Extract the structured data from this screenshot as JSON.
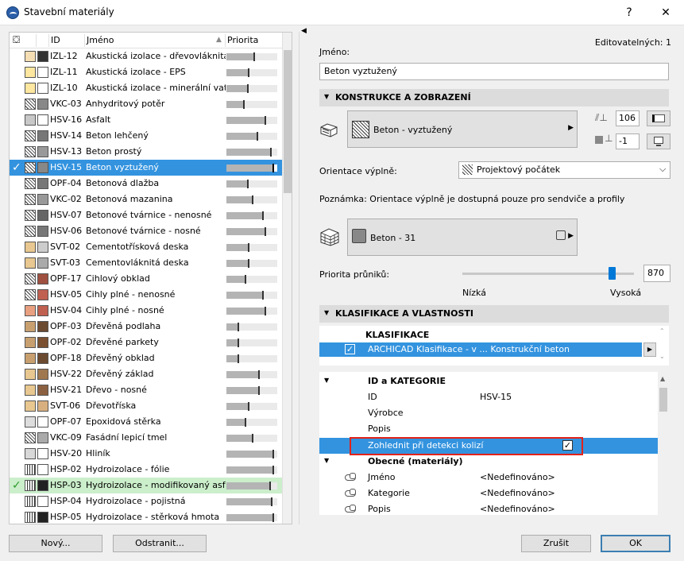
{
  "window": {
    "title": "Stavební materiály",
    "help_label": "?",
    "close_label": "✕"
  },
  "list": {
    "headers": {
      "id": "ID",
      "name": "Jméno",
      "priority": "Priorita"
    },
    "rows": [
      {
        "id": "IZL-12",
        "name": "Akustická izolace - dřevovláknitá d",
        "priority": 0.53,
        "sw1": "#f5deb3",
        "sw2": "#333333",
        "check": "",
        "state": ""
      },
      {
        "id": "IZL-11",
        "name": "Akustická izolace - EPS",
        "priority": 0.42,
        "sw1": "#ffe7a0",
        "sw2": "#ffffff",
        "check": "",
        "state": ""
      },
      {
        "id": "IZL-10",
        "name": "Akustická izolace - minerální vata",
        "priority": 0.4,
        "sw1": "#ffe7a0",
        "sw2": "#ffffff",
        "check": "",
        "state": ""
      },
      {
        "id": "VKC-03",
        "name": "Anhydritový potěr",
        "priority": 0.33,
        "sw1": "hatch",
        "sw2": "#888888",
        "check": "",
        "state": ""
      },
      {
        "id": "HSV-16",
        "name": "Asfalt",
        "priority": 0.75,
        "sw1": "#c8c8c8",
        "sw2": "#ffffff",
        "check": "",
        "state": ""
      },
      {
        "id": "HSV-14",
        "name": "Beton lehčený",
        "priority": 0.6,
        "sw1": "hatch",
        "sw2": "#777777",
        "check": "",
        "state": ""
      },
      {
        "id": "HSV-13",
        "name": "Beton prostý",
        "priority": 0.86,
        "sw1": "hatch",
        "sw2": "#999999",
        "check": "",
        "state": ""
      },
      {
        "id": "HSV-15",
        "name": "Beton vyztužený",
        "priority": 0.9,
        "sw1": "hatch",
        "sw2": "#888888",
        "check": "✓",
        "state": "sel"
      },
      {
        "id": "OPF-04",
        "name": "Betonová dlažba",
        "priority": 0.4,
        "sw1": "hatch",
        "sw2": "#777777",
        "check": "",
        "state": ""
      },
      {
        "id": "VKC-02",
        "name": "Betonová mazanina",
        "priority": 0.5,
        "sw1": "hatch",
        "sw2": "#999999",
        "check": "",
        "state": ""
      },
      {
        "id": "HSV-07",
        "name": "Betonové tvárnice - nenosné",
        "priority": 0.7,
        "sw1": "hatch",
        "sw2": "#666666",
        "check": "",
        "state": ""
      },
      {
        "id": "HSV-06",
        "name": "Betonové tvárnice - nosné",
        "priority": 0.75,
        "sw1": "hatch",
        "sw2": "#777777",
        "check": "",
        "state": ""
      },
      {
        "id": "SVT-02",
        "name": "Cementotřísková deska",
        "priority": 0.42,
        "sw1": "#e8c890",
        "sw2": "#cccccc",
        "check": "",
        "state": ""
      },
      {
        "id": "SVT-03",
        "name": "Cementovláknitá deska",
        "priority": 0.42,
        "sw1": "#e8c890",
        "sw2": "#aaaaaa",
        "check": "",
        "state": ""
      },
      {
        "id": "OPF-17",
        "name": "Cihlový obklad",
        "priority": 0.36,
        "sw1": "hatch",
        "sw2": "#a05040",
        "check": "",
        "state": ""
      },
      {
        "id": "HSV-05",
        "name": "Cihly plné - nenosné",
        "priority": 0.7,
        "sw1": "hatch",
        "sw2": "#c06050",
        "check": "",
        "state": ""
      },
      {
        "id": "HSV-04",
        "name": "Cihly plné - nosné",
        "priority": 0.75,
        "sw1": "#e8a080",
        "sw2": "#c06050",
        "check": "",
        "state": ""
      },
      {
        "id": "OPF-03",
        "name": "Dřevěná podlaha",
        "priority": 0.22,
        "sw1": "#c8a070",
        "sw2": "#6b4a30",
        "check": "",
        "state": ""
      },
      {
        "id": "OPF-02",
        "name": "Dřevěné parkety",
        "priority": 0.22,
        "sw1": "#c8a070",
        "sw2": "#7a5030",
        "check": "",
        "state": ""
      },
      {
        "id": "OPF-18",
        "name": "Dřevěný obklad",
        "priority": 0.22,
        "sw1": "#c8a070",
        "sw2": "#6b4a30",
        "check": "",
        "state": ""
      },
      {
        "id": "HSV-22",
        "name": "Dřevěný základ",
        "priority": 0.62,
        "sw1": "#e8c890",
        "sw2": "#a07850",
        "check": "",
        "state": ""
      },
      {
        "id": "HSV-21",
        "name": "Dřevo - nosné",
        "priority": 0.62,
        "sw1": "#e8c890",
        "sw2": "#8b6040",
        "check": "",
        "state": ""
      },
      {
        "id": "SVT-06",
        "name": "Dřevotříska",
        "priority": 0.42,
        "sw1": "#e8c890",
        "sw2": "#d8b080",
        "check": "",
        "state": ""
      },
      {
        "id": "OPF-07",
        "name": "Epoxidová stěrka",
        "priority": 0.36,
        "sw1": "#dddddd",
        "sw2": "#ffffff",
        "check": "",
        "state": ""
      },
      {
        "id": "VKC-09",
        "name": "Fasádní lepicí tmel",
        "priority": 0.5,
        "sw1": "hatch",
        "sw2": "#aaaaaa",
        "check": "",
        "state": ""
      },
      {
        "id": "HSV-20",
        "name": "Hliník",
        "priority": 0.9,
        "sw1": "#d8d8d8",
        "sw2": "#ffffff",
        "check": "",
        "state": ""
      },
      {
        "id": "HSP-02",
        "name": "Hydroizolace - fólie",
        "priority": 0.9,
        "sw1": "vlines",
        "sw2": "#ffffff",
        "check": "",
        "state": ""
      },
      {
        "id": "HSP-03",
        "name": "Hydroizolace - modifikovaný asfalt",
        "priority": 0.85,
        "sw1": "vlines",
        "sw2": "#222222",
        "check": "✓",
        "state": "hl"
      },
      {
        "id": "HSP-04",
        "name": "Hydroizolace - pojistná",
        "priority": 0.88,
        "sw1": "vlines",
        "sw2": "#ffffff",
        "check": "",
        "state": ""
      },
      {
        "id": "HSP-05",
        "name": "Hydroizolace - stěrková hmota",
        "priority": 0.9,
        "sw1": "vlines",
        "sw2": "#222222",
        "check": "",
        "state": ""
      }
    ]
  },
  "buttons": {
    "new": "Nový...",
    "delete": "Odstranit...",
    "cancel": "Zrušit",
    "ok": "OK"
  },
  "editable_count": "Editovatelných: 1",
  "name_label": "Jméno:",
  "name_value": "Beton vyztužený",
  "sec_construction": "KONSTRUKCE A ZOBRAZENÍ",
  "fill_name": "Beton - vyztužený",
  "pen1": "106",
  "pen2": "-1",
  "orientation_label": "Orientace výplně:",
  "orientation_value": "Projektový počátek",
  "note": "Poznámka: Orientace výplně je dostupná pouze pro sendviče a profily",
  "surface_name": "Beton - 31",
  "priority_label": "Priorita průniků:",
  "priority_value": "870",
  "priority_level": 0.87,
  "low_label": "Nízká",
  "high_label": "Vysoká",
  "sec_classification": "KLASIFIKACE A VLASTNOSTI",
  "class_header": "KLASIFIKACE",
  "class_row": "ARCHICAD Klasifikace - v ...  Konstrukční beton",
  "id_cat_header": "ID a KATEGORIE",
  "props_id": [
    {
      "name": "ID",
      "value": "HSV-15"
    },
    {
      "name": "Výrobce",
      "value": ""
    },
    {
      "name": "Popis",
      "value": ""
    }
  ],
  "collision_label": "Zohlednit při detekci kolizí",
  "general_header": "Obecné (materiály)",
  "props_general": [
    {
      "name": "Jméno",
      "value": "<Nedefinováno>"
    },
    {
      "name": "Kategorie",
      "value": "<Nedefinováno>"
    },
    {
      "name": "Popis",
      "value": "<Nedefinováno>"
    }
  ]
}
